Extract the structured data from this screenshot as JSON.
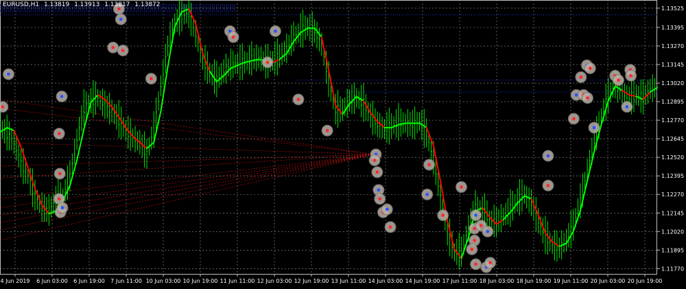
{
  "chart_data": {
    "type": "line",
    "symbol": "EURUSD,H1",
    "ohlc_readout": [
      "1.13819",
      "1.13913",
      "1.13817",
      "1.13872"
    ],
    "y_ticks": [
      "1.13525",
      "1.13395",
      "1.13270",
      "1.13145",
      "1.13020",
      "1.12895",
      "1.12770",
      "1.12645",
      "1.12520",
      "1.12395",
      "1.12270",
      "1.12145",
      "1.12020",
      "1.11895",
      "1.11770"
    ],
    "ylim": [
      1.1173,
      1.1358
    ],
    "x_ticks": [
      "4 Jun 2019",
      "6 Jun 03:00",
      "6 Jun 19:00",
      "7 Jun 11:00",
      "10 Jun 03:00",
      "10 Jun 19:00",
      "11 Jun 11:00",
      "12 Jun 03:00",
      "12 Jun 19:00",
      "13 Jun 11:00",
      "14 Jun 03:00",
      "14 Jun 19:00",
      "17 Jun 11:00",
      "18 Jun 03:00",
      "18 Jun 19:00",
      "19 Jun 11:00",
      "20 Jun 03:00",
      "20 Jun 19:00"
    ],
    "colors": {
      "background": "#000000",
      "grid": "#9a9a9a",
      "bars": "#00ff00",
      "ma_up": "#00ff00",
      "ma_down": "#ff0000",
      "levels": "#1a2fd6",
      "fan": "#c01010",
      "marker_ring": "#b9b0a8"
    },
    "series": [
      {
        "kind": "moving-average",
        "values": [
          1.1269,
          1.1272,
          1.127,
          1.1259,
          1.1245,
          1.1231,
          1.122,
          1.1214,
          1.1216,
          1.1223,
          1.1233,
          1.125,
          1.1271,
          1.1289,
          1.1294,
          1.1291,
          1.1286,
          1.1279,
          1.1272,
          1.1266,
          1.1262,
          1.1258,
          1.1262,
          1.1283,
          1.1313,
          1.134,
          1.135,
          1.1352,
          1.1342,
          1.1322,
          1.131,
          1.1303,
          1.1307,
          1.1312,
          1.1314,
          1.1316,
          1.1317,
          1.1318,
          1.1317,
          1.1316,
          1.1318,
          1.1322,
          1.133,
          1.1336,
          1.1339,
          1.1339,
          1.1333,
          1.1311,
          1.1287,
          1.1281,
          1.1288,
          1.1293,
          1.129,
          1.1282,
          1.1276,
          1.1272,
          1.1272,
          1.1274,
          1.1275,
          1.1275,
          1.1275,
          1.1272,
          1.126,
          1.1236,
          1.1209,
          1.119,
          1.1184,
          1.1198,
          1.1216,
          1.1218,
          1.1212,
          1.1207,
          1.121,
          1.1215,
          1.1221,
          1.1226,
          1.1224,
          1.1213,
          1.1201,
          1.1195,
          1.1192,
          1.1194,
          1.1202,
          1.1216,
          1.1236,
          1.1256,
          1.1274,
          1.129,
          1.13,
          1.1297,
          1.1294,
          1.1293,
          1.1291,
          1.1296,
          1.1299
        ],
        "trend": [
          "up",
          "up",
          "down",
          "down",
          "down",
          "down",
          "down",
          "up",
          "up",
          "up",
          "up",
          "up",
          "up",
          "up",
          "down",
          "down",
          "down",
          "down",
          "down",
          "down",
          "down",
          "up",
          "up",
          "up",
          "up",
          "up",
          "up",
          "down",
          "down",
          "down",
          "up",
          "up",
          "up",
          "up",
          "up",
          "up",
          "up",
          "up",
          "up",
          "down",
          "up",
          "up",
          "up",
          "up",
          "up",
          "up",
          "down",
          "down",
          "down",
          "up",
          "up",
          "up",
          "down",
          "down",
          "down",
          "up",
          "up",
          "up",
          "up",
          "up",
          "up",
          "down",
          "down",
          "down",
          "down",
          "down",
          "up",
          "up",
          "up",
          "down",
          "down",
          "down",
          "up",
          "up",
          "up",
          "up",
          "down",
          "down",
          "down",
          "down",
          "up",
          "up",
          "up",
          "up",
          "up",
          "up",
          "up",
          "up",
          "up",
          "down",
          "down",
          "up",
          "down",
          "up",
          "up"
        ]
      }
    ],
    "bars_close": [
      1.1272,
      1.1268,
      1.1262,
      1.1248,
      1.124,
      1.1226,
      1.1218,
      1.1216,
      1.1223,
      1.1225,
      1.1239,
      1.1264,
      1.1285,
      1.129,
      1.1292,
      1.1287,
      1.1283,
      1.1277,
      1.127,
      1.1265,
      1.1262,
      1.1254,
      1.127,
      1.13,
      1.1327,
      1.1342,
      1.1348,
      1.1349,
      1.1335,
      1.1318,
      1.1309,
      1.1304,
      1.131,
      1.1314,
      1.1315,
      1.1316,
      1.1318,
      1.1319,
      1.1316,
      1.1317,
      1.132,
      1.1325,
      1.1333,
      1.1337,
      1.134,
      1.1337,
      1.1328,
      1.1304,
      1.1284,
      1.1284,
      1.129,
      1.1292,
      1.1288,
      1.128,
      1.1274,
      1.1271,
      1.1273,
      1.1275,
      1.1275,
      1.1274,
      1.1276,
      1.1268,
      1.1251,
      1.1225,
      1.1202,
      1.1188,
      1.1188,
      1.1204,
      1.1218,
      1.1216,
      1.121,
      1.1208,
      1.1212,
      1.1217,
      1.1223,
      1.1227,
      1.1221,
      1.1209,
      1.1199,
      1.1193,
      1.1191,
      1.1196,
      1.1206,
      1.1222,
      1.1243,
      1.1262,
      1.1279,
      1.1293,
      1.1301,
      1.1295,
      1.1292,
      1.1294,
      1.1292,
      1.1298,
      1.1299
    ],
    "markers": [
      {
        "x": 0.004,
        "y": 1.1286
      },
      {
        "x": 0.013,
        "y": 1.1308
      },
      {
        "x": 0.09,
        "y": 1.1224
      },
      {
        "x": 0.092,
        "y": 1.1215
      },
      {
        "x": 0.095,
        "y": 1.1218
      },
      {
        "x": 0.091,
        "y": 1.1241
      },
      {
        "x": 0.09,
        "y": 1.1268
      },
      {
        "x": 0.094,
        "y": 1.1293
      },
      {
        "x": 0.172,
        "y": 1.1326
      },
      {
        "x": 0.181,
        "y": 1.1352
      },
      {
        "x": 0.184,
        "y": 1.1345
      },
      {
        "x": 0.187,
        "y": 1.1324
      },
      {
        "x": 0.23,
        "y": 1.1305
      },
      {
        "x": 0.35,
        "y": 1.1337
      },
      {
        "x": 0.355,
        "y": 1.1333
      },
      {
        "x": 0.407,
        "y": 1.1316
      },
      {
        "x": 0.419,
        "y": 1.1337
      },
      {
        "x": 0.454,
        "y": 1.1291
      },
      {
        "x": 0.498,
        "y": 1.127
      },
      {
        "x": 0.572,
        "y": 1.1254
      },
      {
        "x": 0.57,
        "y": 1.125
      },
      {
        "x": 0.574,
        "y": 1.1242
      },
      {
        "x": 0.576,
        "y": 1.123
      },
      {
        "x": 0.578,
        "y": 1.1224
      },
      {
        "x": 0.583,
        "y": 1.1215
      },
      {
        "x": 0.589,
        "y": 1.1217
      },
      {
        "x": 0.594,
        "y": 1.1205
      },
      {
        "x": 0.653,
        "y": 1.1247
      },
      {
        "x": 0.65,
        "y": 1.1227
      },
      {
        "x": 0.674,
        "y": 1.1213
      },
      {
        "x": 0.702,
        "y": 1.1232
      },
      {
        "x": 0.724,
        "y": 1.1213
      },
      {
        "x": 0.722,
        "y": 1.1204
      },
      {
        "x": 0.732,
        "y": 1.1206
      },
      {
        "x": 0.742,
        "y": 1.1202
      },
      {
        "x": 0.722,
        "y": 1.1196
      },
      {
        "x": 0.724,
        "y": 1.118
      },
      {
        "x": 0.74,
        "y": 1.1178
      },
      {
        "x": 0.746,
        "y": 1.1181
      },
      {
        "x": 0.718,
        "y": 1.119
      },
      {
        "x": 0.834,
        "y": 1.1253
      },
      {
        "x": 0.834,
        "y": 1.1233
      },
      {
        "x": 0.873,
        "y": 1.1278
      },
      {
        "x": 0.877,
        "y": 1.1294
      },
      {
        "x": 0.884,
        "y": 1.1306
      },
      {
        "x": 0.888,
        "y": 1.1294
      },
      {
        "x": 0.893,
        "y": 1.1314
      },
      {
        "x": 0.898,
        "y": 1.1312
      },
      {
        "x": 0.894,
        "y": 1.1292
      },
      {
        "x": 0.904,
        "y": 1.1272
      },
      {
        "x": 0.936,
        "y": 1.1307
      },
      {
        "x": 0.941,
        "y": 1.1304
      },
      {
        "x": 0.954,
        "y": 1.1286
      },
      {
        "x": 0.959,
        "y": 1.1311
      },
      {
        "x": 0.96,
        "y": 1.1307
      }
    ],
    "levels": [
      {
        "y": 1.1355,
        "x_from": 0.0,
        "x_to": 0.36
      },
      {
        "y": 1.1354,
        "x_from": 0.0,
        "x_to": 0.36
      },
      {
        "y": 1.1353,
        "x_from": 0.0,
        "x_to": 0.36
      },
      {
        "y": 1.1352,
        "x_from": 0.0,
        "x_to": 0.36
      },
      {
        "y": 1.1351,
        "x_from": 0.0,
        "x_to": 0.36
      },
      {
        "y": 1.135,
        "x_from": 0.0,
        "x_to": 0.36
      },
      {
        "y": 1.1348,
        "x_from": 0.0,
        "x_to": 1.0
      },
      {
        "y": 1.1304,
        "x_from": 0.45,
        "x_to": 1.0
      },
      {
        "y": 1.1296,
        "x_from": 0.52,
        "x_to": 1.0
      }
    ],
    "fan_origin": {
      "x": 0.57,
      "y": 1.1254
    },
    "fan_targets": [
      1.1291,
      1.1285,
      1.1262,
      1.1246,
      1.1238,
      1.1224,
      1.1218,
      1.1213,
      1.1208,
      1.1203,
      1.1196
    ]
  }
}
